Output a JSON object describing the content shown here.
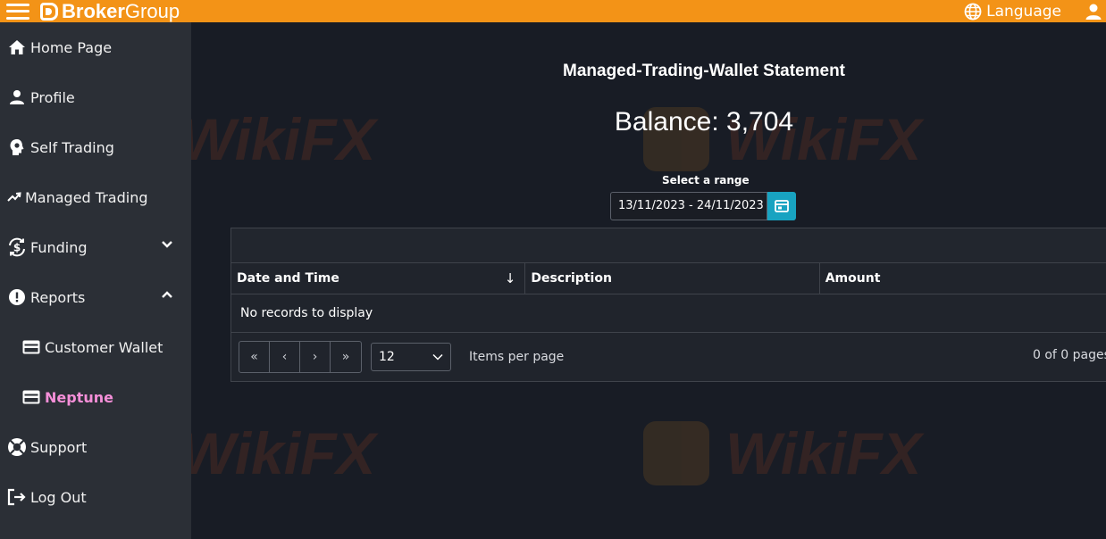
{
  "header": {
    "brand_bold": "Broker",
    "brand_light": "Group",
    "language_label": "Language",
    "icons": [
      "menu-icon",
      "globe-icon",
      "user-icon"
    ],
    "accent_color": "#f39317"
  },
  "sidebar": {
    "items": [
      {
        "label": "Home Page",
        "icon": "home-icon"
      },
      {
        "label": "Profile",
        "icon": "person-icon"
      },
      {
        "label": "Self Trading",
        "icon": "gear-head-icon"
      },
      {
        "label": "Managed Trading",
        "icon": "trend-up-icon"
      },
      {
        "label": "Funding",
        "icon": "dollar-exchange-icon",
        "expanded": false
      },
      {
        "label": "Reports",
        "icon": "alert-icon",
        "expanded": true
      },
      {
        "label": "Customer Wallet",
        "icon": "card-icon",
        "sub": true
      },
      {
        "label": "Neptune",
        "icon": "card-icon",
        "sub": true,
        "active": true
      },
      {
        "label": "Support",
        "icon": "lifebuoy-icon"
      },
      {
        "label": "Log Out",
        "icon": "logout-icon"
      }
    ],
    "active_color": "#f48fd8"
  },
  "main": {
    "title": "Managed-Trading-Wallet Statement",
    "balance": "Balance: 3,704",
    "range_label": "Select a range",
    "range_value": "13/11/2023 - 24/11/2023",
    "table": {
      "columns": [
        "Date and Time",
        "Description",
        "Amount"
      ],
      "sort_indicator": "↓",
      "empty_message": "No records to display"
    },
    "pager": {
      "buttons": [
        "«",
        "‹",
        "›",
        "»"
      ],
      "page_size": "12",
      "items_per_page_label": "Items per page",
      "page_info": "0 of 0 pages"
    }
  },
  "watermark": {
    "text": "WikiFX"
  }
}
